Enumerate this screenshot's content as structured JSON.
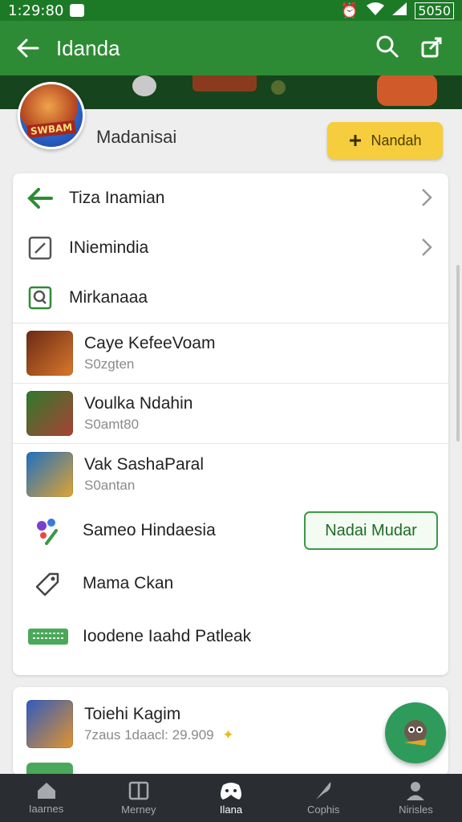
{
  "status_bar": {
    "time": "1:29:80",
    "battery": "5050"
  },
  "app_bar": {
    "title": "Idanda"
  },
  "profile": {
    "avatar_text": "SWBAM",
    "name": "Madanisai",
    "follow_button": "Nandah"
  },
  "menu": [
    {
      "label": "Tiza Inamian",
      "icon": "arrow-left-icon"
    },
    {
      "label": "INiemindia",
      "icon": "pencil-icon"
    },
    {
      "label": "Mirkanaaa",
      "icon": "search-box-icon"
    }
  ],
  "games": [
    {
      "title": "Caye KefeeVoam",
      "subtitle": "S0zgten",
      "thumb_colors": [
        "#6b2a15",
        "#d9782c"
      ]
    },
    {
      "title": "Voulka Ndahin",
      "subtitle": "S0amt80",
      "thumb_colors": [
        "#2f7a2c",
        "#a94233"
      ]
    },
    {
      "title": "Vak SashaParal",
      "subtitle": "S0antan",
      "thumb_colors": [
        "#1f6fc2",
        "#e0a431"
      ]
    }
  ],
  "actions": [
    {
      "label": "Sameo Hindaesia",
      "button": "Nadai Mudar",
      "icon": "paint-palette-icon"
    },
    {
      "label": "Mama Ckan",
      "icon": "tag-icon"
    },
    {
      "label": "Ioodene Iaahd Patleak",
      "icon": "keyboard-icon"
    }
  ],
  "featured": {
    "title": "Toiehi Kagim",
    "subtitle": "7zaus 1daacl: 29.909"
  },
  "bottom_nav": [
    {
      "label": "Iaarnes",
      "icon": "home-icon"
    },
    {
      "label": "Merney",
      "icon": "book-icon"
    },
    {
      "label": "Ilana",
      "icon": "gamepad-icon",
      "active": true
    },
    {
      "label": "Cophis",
      "icon": "feather-icon"
    },
    {
      "label": "Nirisles",
      "icon": "person-icon"
    }
  ],
  "colors": {
    "primary": "#2e8b35",
    "accent": "#f6cd3c",
    "nav_bg": "#2a2d31"
  }
}
